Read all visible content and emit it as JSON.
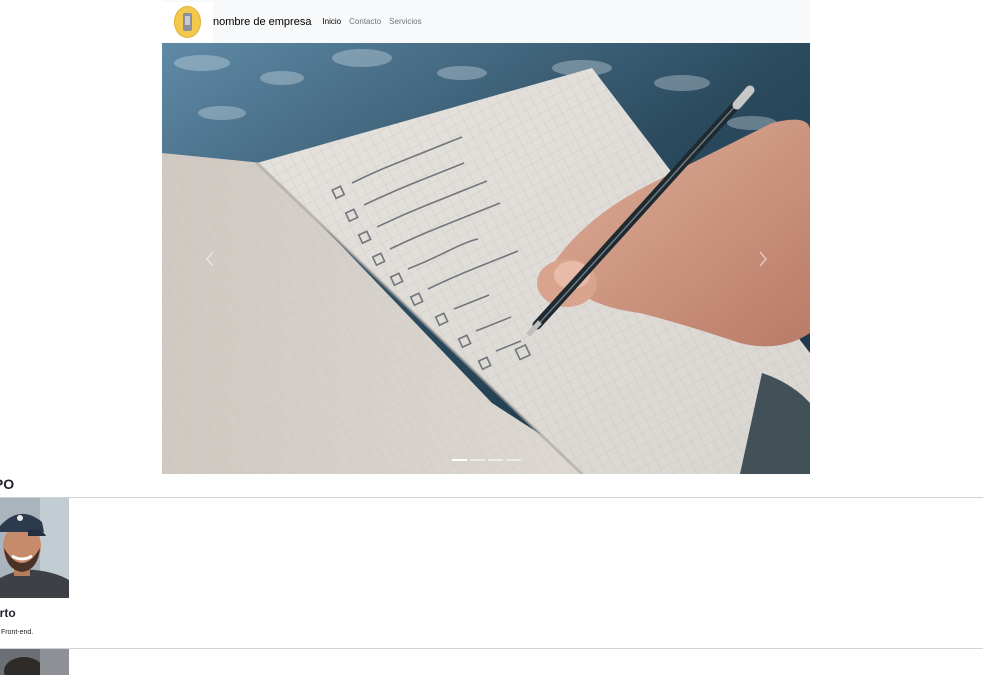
{
  "navbar": {
    "brand_name": "nombre de empresa",
    "logo_icon": "phone-logo-icon",
    "links": [
      {
        "label": "Inicio",
        "active": true
      },
      {
        "label": "Contacto",
        "active": false
      },
      {
        "label": "Servicios",
        "active": false
      }
    ]
  },
  "carousel": {
    "slide_image": "hand writing checklist in notebook",
    "prev_icon": "chevron-left-icon",
    "next_icon": "chevron-right-icon",
    "indicators_count": 4,
    "active_indicator": 1
  },
  "team": {
    "heading": "IPO",
    "members": [
      {
        "name": "erto",
        "role": "ador Front-end."
      },
      {
        "name": "",
        "role": ""
      }
    ]
  },
  "colors": {
    "navbar_bg": "#f8f9fa",
    "logo_yellow": "#f2c94c",
    "divider": "#cfd2d6"
  }
}
